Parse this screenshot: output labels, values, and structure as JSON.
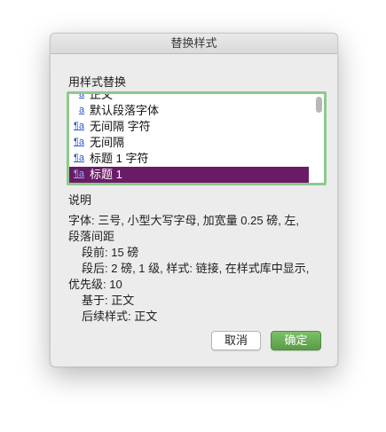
{
  "dialog": {
    "title": "替换样式",
    "list_label": "用样式替换",
    "style_list": {
      "items": [
        {
          "icon": "a",
          "icon_name": "character-style-icon",
          "label": "正文",
          "selected": false
        },
        {
          "icon": "a",
          "icon_name": "character-style-icon",
          "label": "默认段落字体",
          "selected": false
        },
        {
          "icon": "¶a",
          "icon_name": "linked-style-icon",
          "label": "无间隔 字符",
          "selected": false
        },
        {
          "icon": "¶a",
          "icon_name": "linked-style-icon",
          "label": "无间隔",
          "selected": false
        },
        {
          "icon": "¶a",
          "icon_name": "linked-style-icon",
          "label": "标题 1 字符",
          "selected": false
        },
        {
          "icon": "¶a",
          "icon_name": "linked-style-icon",
          "label": "标题 1",
          "selected": true
        }
      ],
      "selection_color": "#6a1b66",
      "focus_ring_color": "#8fc98c"
    },
    "description": {
      "label": "说明",
      "line1": "字体: 三号, 小型大写字母, 加宽量  0.25 磅, 左,",
      "line2": "段落间距",
      "line3": "段前: 15 磅",
      "line4": "段后: 2 磅, 1 级, 样式: 链接, 在样式库中显示,",
      "line5": "优先级: 10",
      "line6": "基于: 正文",
      "line7": "后续样式: 正文"
    },
    "buttons": {
      "cancel_label": "取消",
      "ok_label": "确定",
      "ok_color": "#5fa34b"
    }
  }
}
